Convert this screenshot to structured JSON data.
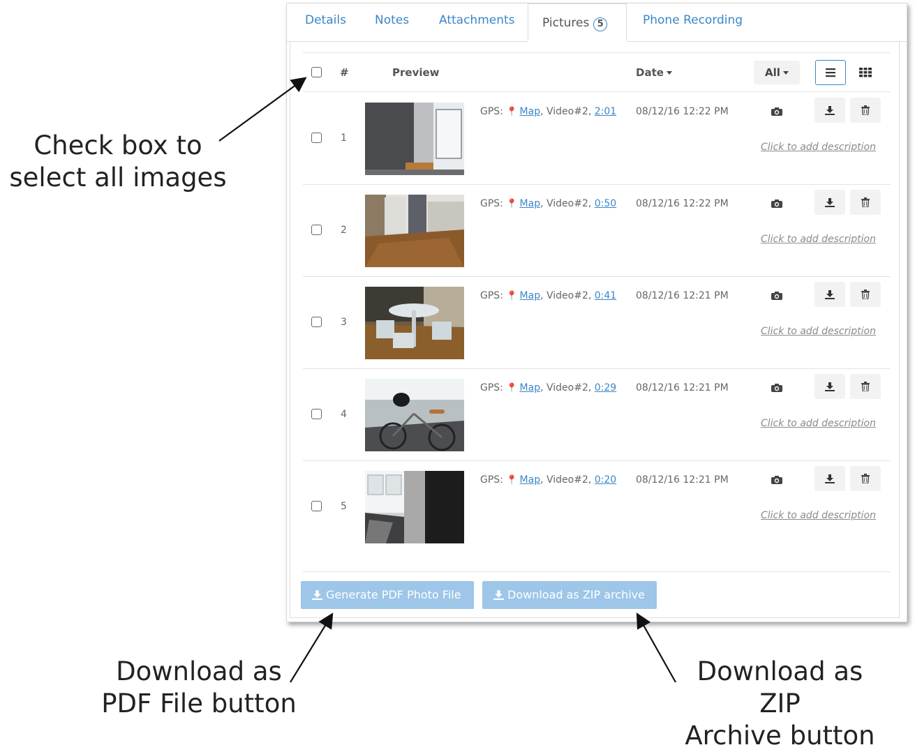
{
  "tabs": [
    {
      "label": "Details"
    },
    {
      "label": "Notes"
    },
    {
      "label": "Attachments"
    },
    {
      "label": "Pictures",
      "count": "5"
    },
    {
      "label": "Phone Recording"
    }
  ],
  "table": {
    "col_number": "#",
    "col_preview": "Preview",
    "col_date": "Date",
    "filter_label": "All"
  },
  "rows": [
    {
      "num": "1",
      "gps_label": "GPS:",
      "map_label": "Map",
      "video_label": ", Video#2,",
      "time": "2:01",
      "date": "08/12/16 12:22 PM",
      "description": "Click to add description"
    },
    {
      "num": "2",
      "gps_label": "GPS:",
      "map_label": "Map",
      "video_label": ", Video#2,",
      "time": "0:50",
      "date": "08/12/16 12:22 PM",
      "description": "Click to add description"
    },
    {
      "num": "3",
      "gps_label": "GPS:",
      "map_label": "Map",
      "video_label": ", Video#2,",
      "time": "0:41",
      "date": "08/12/16 12:21 PM",
      "description": "Click to add description"
    },
    {
      "num": "4",
      "gps_label": "GPS:",
      "map_label": "Map",
      "video_label": ", Video#2,",
      "time": "0:29",
      "date": "08/12/16 12:21 PM",
      "description": "Click to add description"
    },
    {
      "num": "5",
      "gps_label": "GPS:",
      "map_label": "Map",
      "video_label": ", Video#2,",
      "time": "0:20",
      "date": "08/12/16 12:21 PM",
      "description": "Click to add description"
    }
  ],
  "buttons": {
    "generate_pdf": "Generate PDF Photo File",
    "download_zip": "Download as ZIP archive"
  },
  "annotations": {
    "select_all_line1": "Check box to",
    "select_all_line2": "select all images",
    "pdf_line1": "Download as",
    "pdf_line2": "PDF File button",
    "zip_line1": "Download as ZIP",
    "zip_line2": "Archive button"
  },
  "colors": {
    "link": "#3a86c8",
    "button_disabled_blue": "#9dc6e8"
  }
}
